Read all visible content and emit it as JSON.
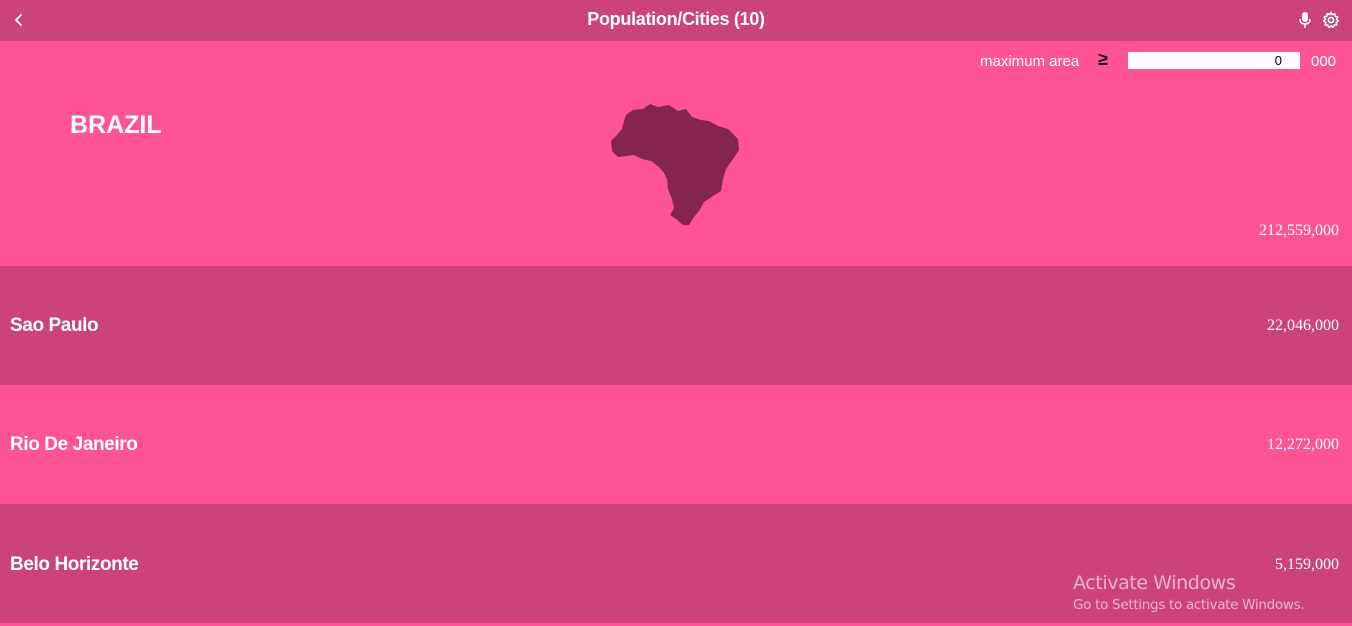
{
  "header": {
    "title": "Population/Cities (10)",
    "back_icon": "chevron-left-icon",
    "mic_icon": "microphone-icon",
    "settings_icon": "gear-icon"
  },
  "filter": {
    "label": "maximum area",
    "operator": "≥",
    "value": "0",
    "unit": "000"
  },
  "country": {
    "name": "BRAZIL",
    "population": "212,559,000",
    "map_icon": "brazil-map-icon"
  },
  "cities": [
    {
      "name": "Sao Paulo",
      "population": "22,046,000"
    },
    {
      "name": "Rio De Janeiro",
      "population": "12,272,000"
    },
    {
      "name": "Belo Horizonte",
      "population": "5,159,000"
    }
  ],
  "watermark": {
    "title": "Activate Windows",
    "subtitle": "Go to Settings to activate Windows."
  },
  "colors": {
    "header_bg": "#cc4477",
    "light_row": "#ff5494",
    "dark_row": "#cc4477",
    "map_fill": "#84264a"
  }
}
